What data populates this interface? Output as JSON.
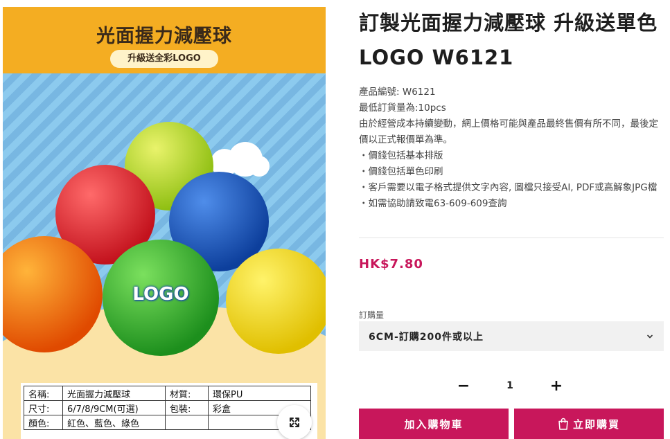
{
  "image": {
    "title": "光面握力減壓球",
    "subtitle": "升級送全彩LOGO",
    "logo_text": "LOGO",
    "specs": [
      [
        "名稱:",
        "光面握力減壓球",
        "材質:",
        "環保PU"
      ],
      [
        "尺寸:",
        "6/7/8/9CM(可選)",
        "包裝:",
        "彩盒"
      ],
      [
        "顏色:",
        "紅色、藍色、綠色",
        "",
        ""
      ]
    ],
    "zoom_icon": "expand-arrows-icon"
  },
  "product": {
    "title": "訂製光面握力減壓球 升級送單色LOGO W6121",
    "meta": [
      "產品編號: W6121",
      "最低訂貨量為:10pcs",
      "由於經營成本持續變動，網上價格可能與產品最終售價有所不同，最後定價以正式報價單為準。",
      "・價錢包括基本排版",
      "・價錢包括單色印刷",
      "・客戶需要以電子格式提供文字內容, 圖檔只接受AI, PDF或高解象JPG檔",
      "・如需協助請致電63-609-609查詢"
    ],
    "price": "HK$7.80",
    "quantity_label": "訂購量",
    "quantity_option": "6CM-訂購200件或以上",
    "quantity_value": "1",
    "minus_label": "−",
    "plus_label": "+",
    "add_to_cart_label": "加入購物車",
    "buy_now_label": "立即購買"
  },
  "colors": {
    "accent": "#c8175b",
    "banner": "#f4ad22",
    "sky": "#87c3ea"
  }
}
